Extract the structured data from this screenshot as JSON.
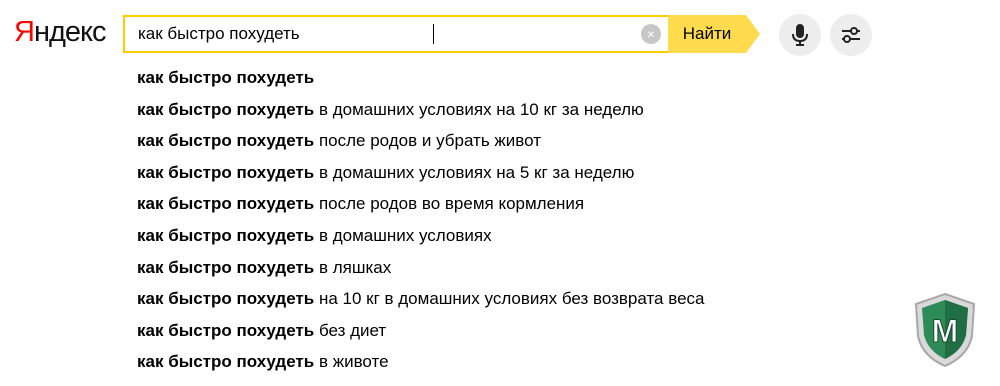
{
  "logo": {
    "first": "Я",
    "rest": "ндекс"
  },
  "search": {
    "value": "как быстро похудеть",
    "clear": "×"
  },
  "find_button": "Найти",
  "icons": {
    "mic": "microphone-icon",
    "settings": "sliders-icon",
    "clear": "clear-x-icon"
  },
  "suggestions": [
    {
      "bold": "как быстро похудеть",
      "rest": ""
    },
    {
      "bold": "как быстро похудеть",
      "rest": " в домашних условиях на 10 кг за неделю"
    },
    {
      "bold": "как быстро похудеть",
      "rest": " после родов и убрать живот"
    },
    {
      "bold": "как быстро похудеть",
      "rest": " в домашних условиях на 5 кг за неделю"
    },
    {
      "bold": "как быстро похудеть",
      "rest": " после родов во время кормления"
    },
    {
      "bold": "как быстро похудеть",
      "rest": " в домашних условиях"
    },
    {
      "bold": "как быстро похудеть",
      "rest": " в ляшках"
    },
    {
      "bold": "как быстро похудеть",
      "rest": " на 10 кг в домашних условиях без возврата веса"
    },
    {
      "bold": "как быстро похудеть",
      "rest": " без диет"
    },
    {
      "bold": "как быстро похудеть",
      "rest": " в животе"
    }
  ],
  "watermark": {
    "letter": "M"
  },
  "colors": {
    "brand_red": "#ff0000",
    "accent_yellow": "#ffdb4d",
    "border_yellow": "#ffcc00",
    "badge_green": "#2e8b57"
  }
}
